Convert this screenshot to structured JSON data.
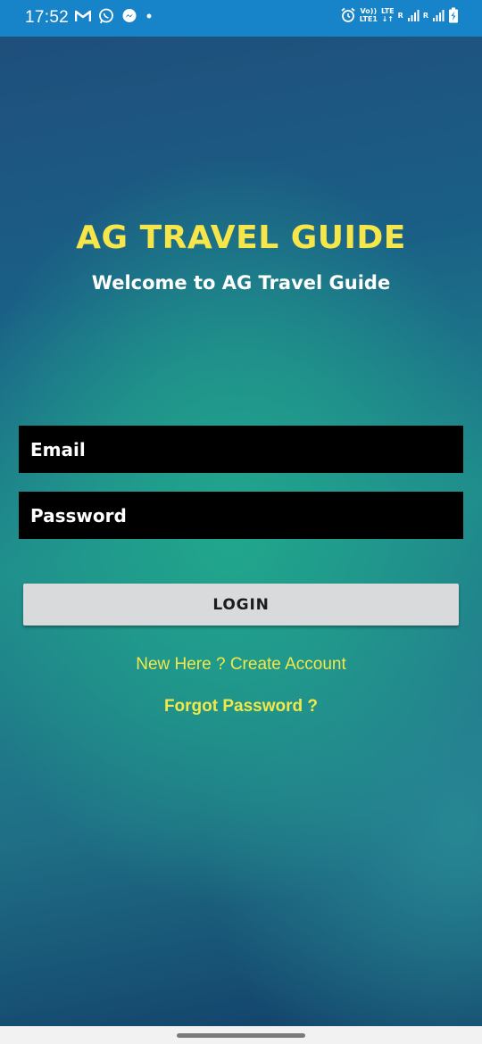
{
  "status_bar": {
    "time": "17:52",
    "left_icons": [
      "gmail-icon",
      "whatsapp-icon",
      "messenger-icon",
      "dot-icon"
    ],
    "network_label_1": "Vo))",
    "network_label_2": "LTE1",
    "lte_label": "LTE",
    "roaming_label": "R"
  },
  "app": {
    "title": "AG TRAVEL GUIDE",
    "subtitle": "Welcome to AG Travel Guide"
  },
  "form": {
    "email_placeholder": "Email",
    "email_value": "",
    "password_placeholder": "Password",
    "password_value": "",
    "login_label": "LOGIN"
  },
  "links": {
    "create_account": "New Here ? Create Account",
    "forgot_password": "Forgot Password ?"
  },
  "colors": {
    "status_bar": "#1784c9",
    "title": "#f6e64a",
    "link": "#f2e84a",
    "input_bg": "#000000",
    "button_bg": "#d8dadb"
  }
}
